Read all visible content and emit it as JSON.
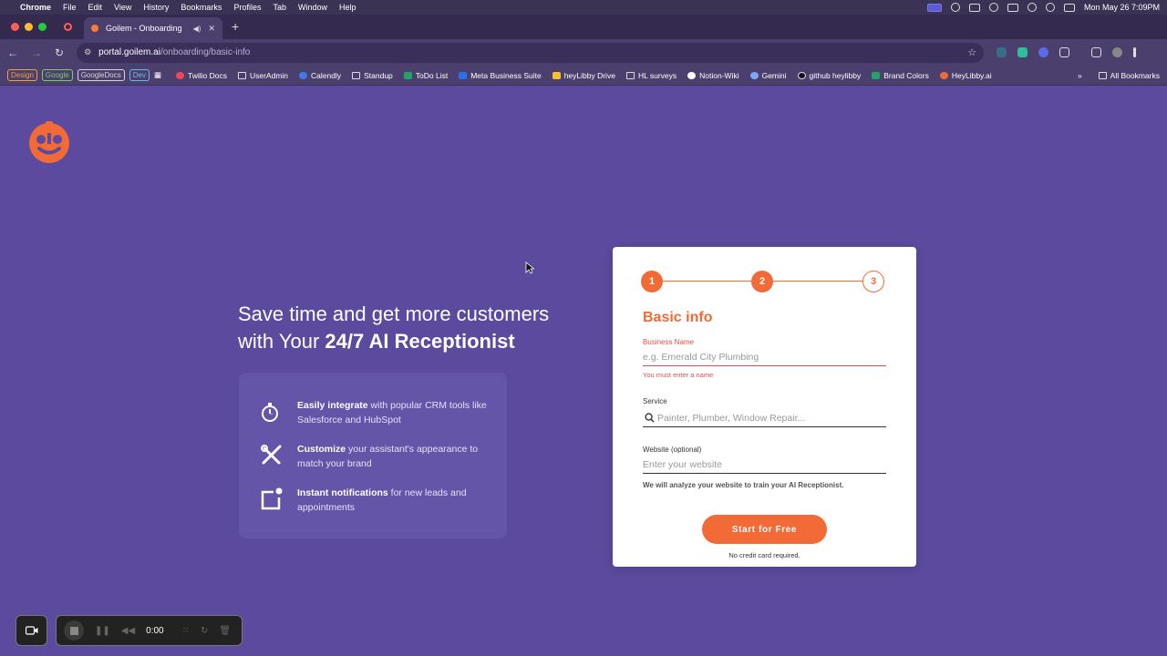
{
  "menubar": {
    "app": "Chrome",
    "items": [
      "File",
      "Edit",
      "View",
      "History",
      "Bookmarks",
      "Profiles",
      "Tab",
      "Window",
      "Help"
    ],
    "clock": "Mon May 26  7:09PM"
  },
  "tab": {
    "title": "Goilem - Onboarding",
    "close": "✕",
    "new": "+"
  },
  "address": {
    "host": "portal.goilem.ai",
    "path": "/onboarding/basic-info"
  },
  "bookmarks": {
    "pills": [
      {
        "label": "Design",
        "color": "#f2a03d"
      },
      {
        "label": "Google",
        "color": "#7ecb6a"
      },
      {
        "label": "GoogleDocs",
        "color": "#d6d6d6"
      },
      {
        "label": "Dev",
        "color": "#6fb7e8"
      }
    ],
    "items": [
      {
        "label": "Twilio Docs",
        "icon": "#f0465b"
      },
      {
        "label": "UserAdmin",
        "icon": "folder"
      },
      {
        "label": "Calendly",
        "icon": "#3d7be8"
      },
      {
        "label": "Standup",
        "icon": "folder"
      },
      {
        "label": "ToDo List",
        "icon": "#21a464"
      },
      {
        "label": "Meta Business Suite",
        "icon": "#2b6ff0"
      },
      {
        "label": "heyLibby Drive",
        "icon": "#f6c12d"
      },
      {
        "label": "HL surveys",
        "icon": "folder"
      },
      {
        "label": "Notion-Wiki",
        "icon": "#ffffff"
      },
      {
        "label": "Gemini",
        "icon": "#7aa7ff"
      },
      {
        "label": "github heylibby",
        "icon": "#000000"
      },
      {
        "label": "Brand Colors",
        "icon": "#21a464"
      },
      {
        "label": "HeyLibby.ai",
        "icon": "#f26a36"
      }
    ],
    "more": "»",
    "all": "All Bookmarks"
  },
  "hero": {
    "line1": "Save time and get more customers",
    "line2_prefix": "with Your ",
    "line2_bold": "24/7 AI Receptionist"
  },
  "features": [
    {
      "bold": "Easily integrate",
      "text": " with popular CRM tools like Salesforce and HubSpot",
      "icon": "stopwatch-icon"
    },
    {
      "bold": "Customize",
      "text": " your assistant's appearance to match your brand",
      "icon": "tools-icon"
    },
    {
      "bold": "Instant notifications",
      "text": " for new leads and appointments",
      "icon": "notification-icon"
    }
  ],
  "form": {
    "steps": [
      "1",
      "2",
      "3"
    ],
    "current_step": 2,
    "title": "Basic info",
    "business_name": {
      "label": "Business Name",
      "placeholder": "e.g. Emerald City Plumbing",
      "value": "",
      "error": "You must enter a name"
    },
    "service": {
      "label": "Service",
      "placeholder": "Painter, Plumber, Window Repair...",
      "value": ""
    },
    "website": {
      "label": "Website (optional)",
      "placeholder": "Enter your website",
      "value": ""
    },
    "note": "We will analyze your website to train your AI Receptionist.",
    "cta": "Start for Free",
    "no_credit": "No credit card required."
  },
  "recorder": {
    "time": "0:00"
  },
  "colors": {
    "brand": "#f26a36",
    "background": "#5b4a9e",
    "error": "#d9534f"
  }
}
